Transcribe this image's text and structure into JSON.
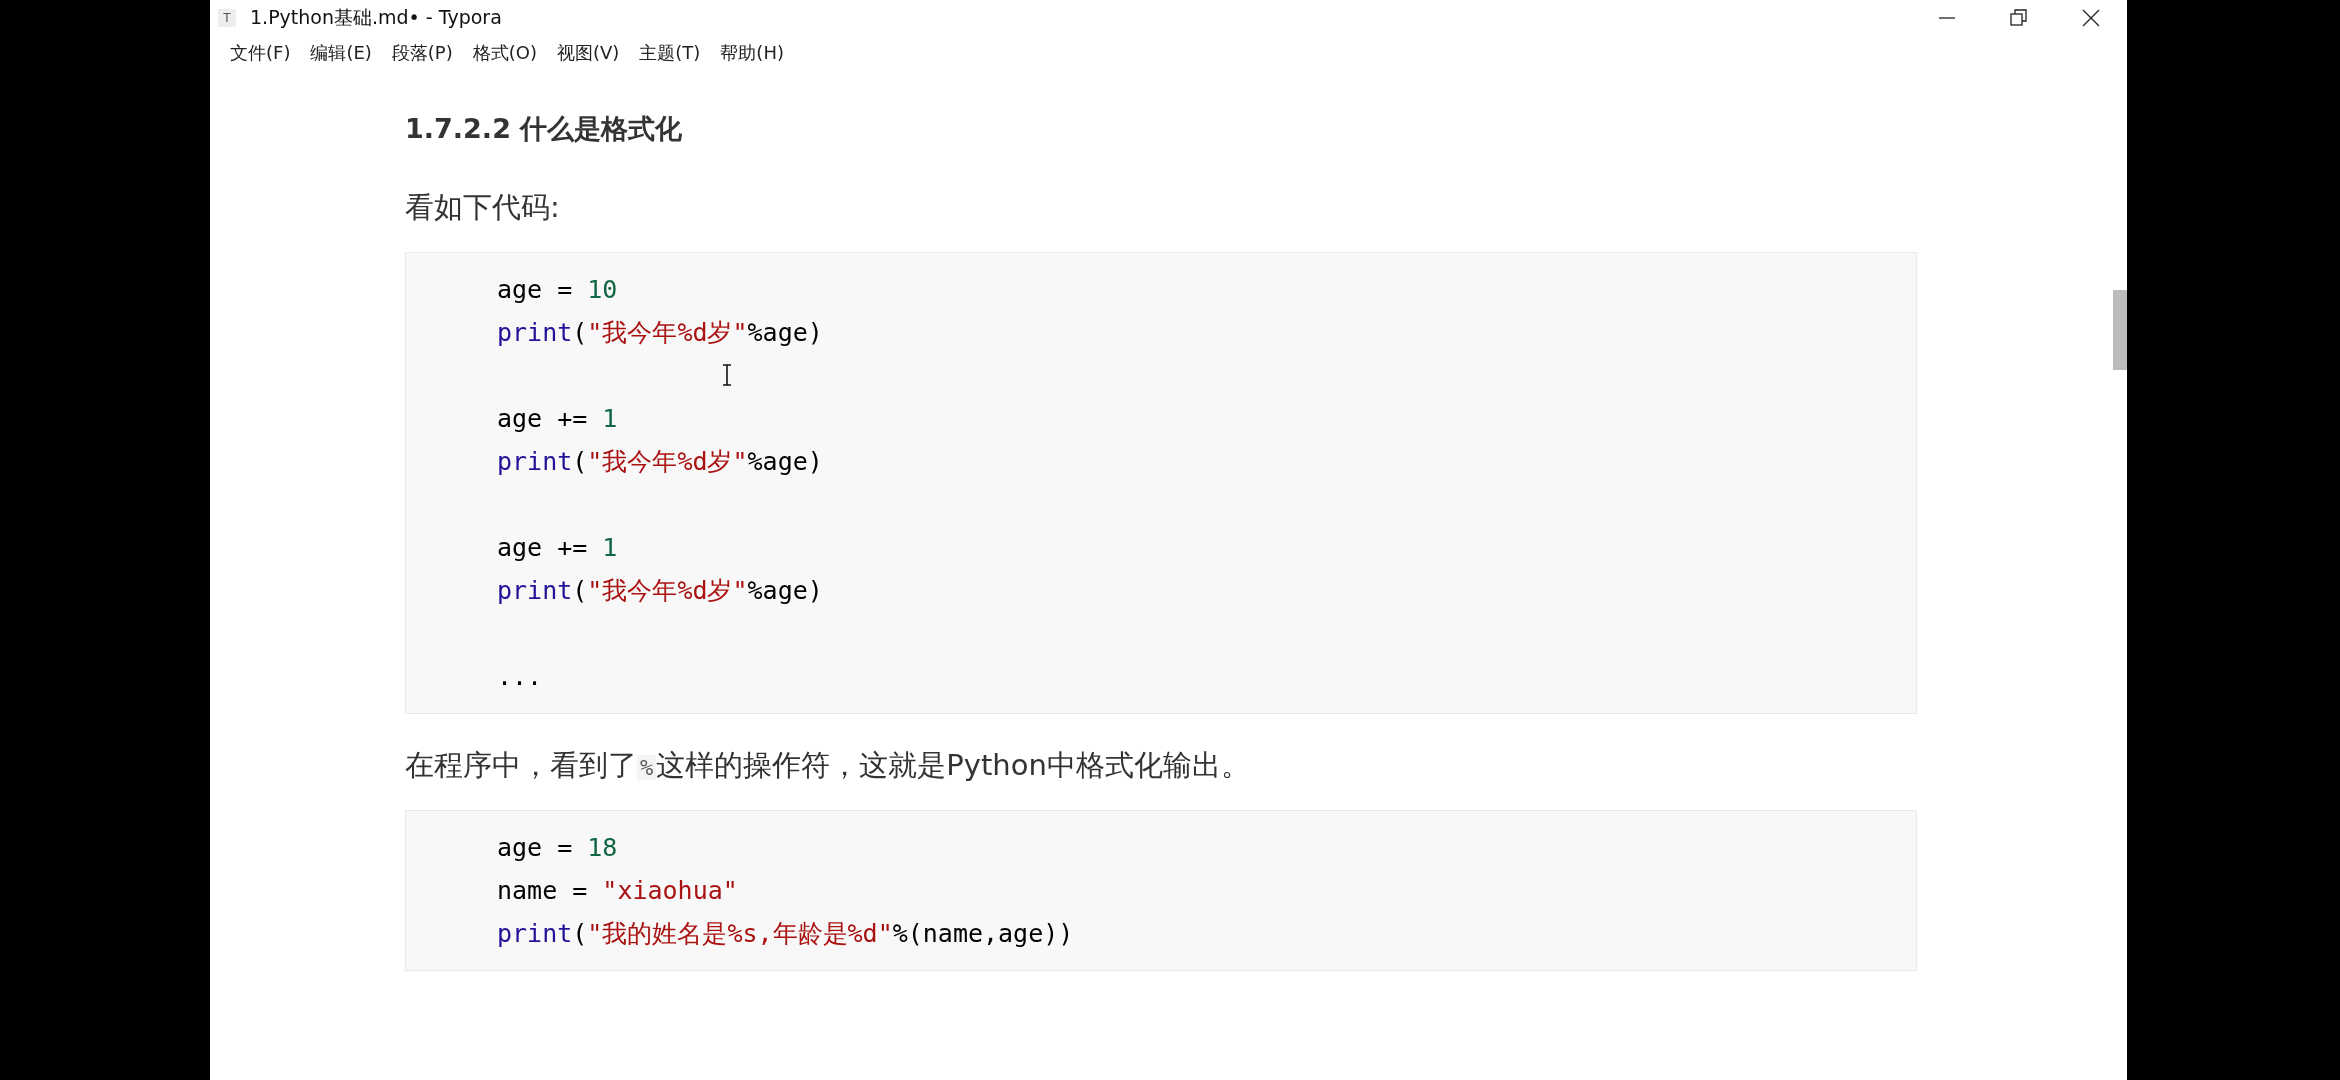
{
  "window": {
    "title": "1.Python基础.md• - Typora",
    "app_icon": "T"
  },
  "menu": [
    "文件(F)",
    "编辑(E)",
    "段落(P)",
    "格式(O)",
    "视图(V)",
    "主题(T)",
    "帮助(H)"
  ],
  "document": [
    {
      "kind": "heading",
      "text": "1.7.2.2 什么是格式化"
    },
    {
      "kind": "paragraph",
      "parts": [
        {
          "kind": "text",
          "text": "看如下代码:"
        }
      ]
    },
    {
      "kind": "code",
      "groups": [
        [
          [
            {
              "kind": "plain",
              "text": "age = "
            },
            {
              "kind": "number",
              "text": "10"
            }
          ],
          [
            {
              "kind": "keyword",
              "text": "print"
            },
            {
              "kind": "plain",
              "text": "("
            },
            {
              "kind": "string",
              "text": "\"我今年%d岁\""
            },
            {
              "kind": "plain",
              "text": "%age)"
            }
          ]
        ],
        [
          [
            {
              "kind": "plain",
              "text": "age += "
            },
            {
              "kind": "number",
              "text": "1"
            }
          ],
          [
            {
              "kind": "keyword",
              "text": "print"
            },
            {
              "kind": "plain",
              "text": "("
            },
            {
              "kind": "string",
              "text": "\"我今年%d岁\""
            },
            {
              "kind": "plain",
              "text": "%age)"
            }
          ]
        ],
        [
          [
            {
              "kind": "plain",
              "text": "age += "
            },
            {
              "kind": "number",
              "text": "1"
            }
          ],
          [
            {
              "kind": "keyword",
              "text": "print"
            },
            {
              "kind": "plain",
              "text": "("
            },
            {
              "kind": "string",
              "text": "\"我今年%d岁\""
            },
            {
              "kind": "plain",
              "text": "%age)"
            }
          ]
        ],
        [
          [
            {
              "kind": "plain",
              "text": "..."
            }
          ]
        ]
      ]
    },
    {
      "kind": "paragraph",
      "parts": [
        {
          "kind": "text",
          "text": "在程序中，看到了"
        },
        {
          "kind": "code",
          "text": "%"
        },
        {
          "kind": "text",
          "text": "这样的操作符，这就是Python中格式化输出。"
        }
      ]
    },
    {
      "kind": "code",
      "groups": [
        [
          [
            {
              "kind": "plain",
              "text": "age = "
            },
            {
              "kind": "number",
              "text": "18"
            }
          ],
          [
            {
              "kind": "plain",
              "text": "name = "
            },
            {
              "kind": "string",
              "text": "\"xiaohua\""
            }
          ],
          [
            {
              "kind": "keyword",
              "text": "print"
            },
            {
              "kind": "plain",
              "text": "("
            },
            {
              "kind": "string",
              "text": "\"我的姓名是%s,年龄是%d\""
            },
            {
              "kind": "plain",
              "text": "%(name,age))"
            }
          ]
        ]
      ]
    }
  ]
}
